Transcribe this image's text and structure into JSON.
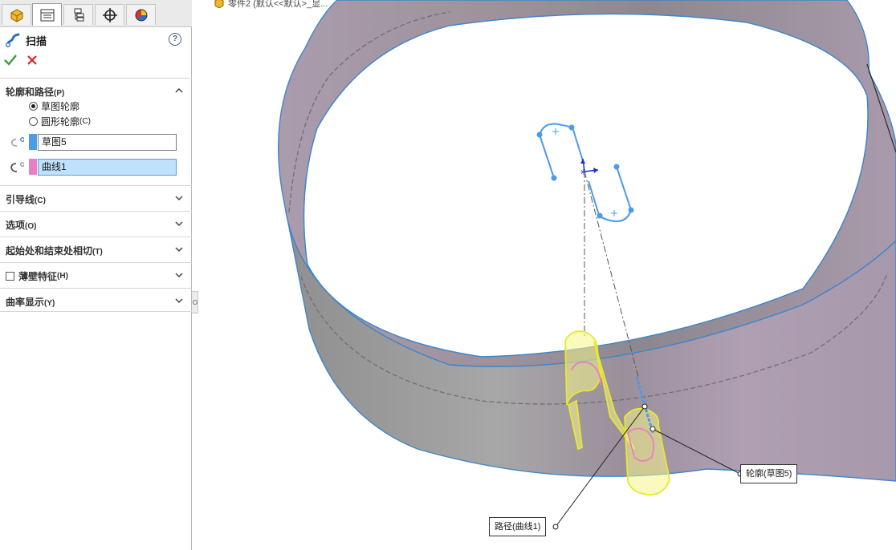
{
  "feature": {
    "title": "扫描",
    "help_glyph": "?"
  },
  "tabs": [
    {
      "name": "feature-manager-tab",
      "icon": "feature-manager-icon"
    },
    {
      "name": "property-manager-tab",
      "icon": "property-manager-icon",
      "active": true
    },
    {
      "name": "configuration-manager-tab",
      "icon": "configuration-manager-icon"
    },
    {
      "name": "dimxpert-manager-tab",
      "icon": "dimxpert-icon"
    },
    {
      "name": "display-manager-tab",
      "icon": "display-manager-icon"
    }
  ],
  "sections": {
    "profile_path": {
      "label": "轮廓和路径",
      "shortcut": "(P)",
      "expanded": true,
      "options": [
        {
          "label": "草图轮廓",
          "shortcut": "",
          "selected": true
        },
        {
          "label": "圆形轮廓",
          "shortcut": "(C)",
          "selected": false
        }
      ],
      "profile_value": "草图5",
      "profile_color": "#4a9be8",
      "path_value": "曲线1",
      "path_color": "#ea7fc6"
    },
    "guide_curves": {
      "label": "引导线",
      "shortcut": "(C)"
    },
    "options": {
      "label": "选项",
      "shortcut": "(O)"
    },
    "tangency": {
      "label": "起始处和结束处相切",
      "shortcut": "(T)"
    },
    "thin_feature": {
      "label": "薄壁特征",
      "shortcut": "(H)",
      "checked": false
    },
    "curvature_display": {
      "label": "曲率显示",
      "shortcut": "(Y)"
    }
  },
  "viewport": {
    "breadcrumb": "零件2 (默认<<默认>_显...",
    "callouts": {
      "profile": "轮廓(草图5)",
      "path": "路径(曲线1)"
    }
  },
  "colors": {
    "accent_blue": "#3f5d8e",
    "ok_green": "#3c9a3c",
    "cancel_red": "#d42424",
    "surface": "#a89aa8",
    "sketch_blue": "#4a9be8",
    "preview_yellow": "#f2f25a"
  }
}
